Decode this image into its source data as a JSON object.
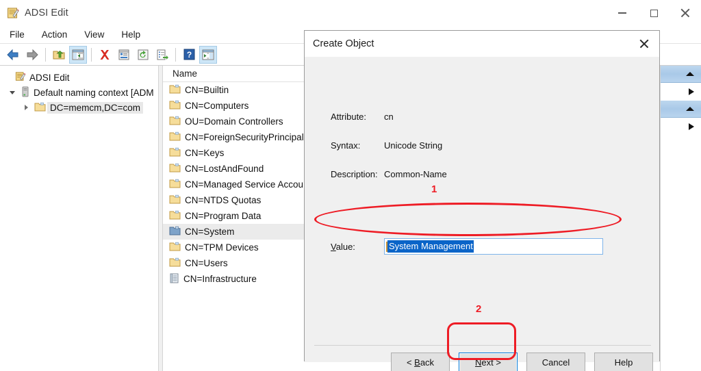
{
  "window": {
    "title": "ADSI Edit",
    "app_icon": "adsi-edit-icon",
    "controls": {
      "minimize": "─",
      "maximize": "□",
      "close": "✕"
    }
  },
  "menubar": {
    "items": [
      "File",
      "Action",
      "View",
      "Help"
    ]
  },
  "toolbar": {
    "items": [
      {
        "name": "back-icon",
        "label": "Back",
        "active": false
      },
      {
        "name": "forward-icon",
        "label": "Forward",
        "active": false
      },
      {
        "name": "up-one-level-icon",
        "label": "Up One Level",
        "active": false
      },
      {
        "name": "show-hide-console-tree-icon",
        "label": "Show/Hide Console Tree",
        "active": true
      },
      {
        "name": "delete-icon",
        "label": "Delete",
        "active": false
      },
      {
        "name": "properties-icon",
        "label": "Properties",
        "active": false
      },
      {
        "name": "refresh-icon",
        "label": "Refresh",
        "active": false
      },
      {
        "name": "export-list-icon",
        "label": "Export List",
        "active": false
      },
      {
        "name": "help-icon",
        "label": "Help",
        "active": false
      },
      {
        "name": "show-hide-action-pane-icon",
        "label": "Show/Hide Action Pane",
        "active": true
      }
    ]
  },
  "tree": {
    "nodes": [
      {
        "label": "ADSI Edit",
        "icon": "adsi-edit-icon",
        "indent": 0,
        "twisty": "none",
        "selected": false
      },
      {
        "label": "Default naming context [ADM",
        "icon": "server-icon",
        "indent": 1,
        "twisty": "expanded",
        "selected": false
      },
      {
        "label": "DC=memcm,DC=com",
        "icon": "folder-icon",
        "indent": 2,
        "twisty": "collapsed",
        "selected": true
      }
    ]
  },
  "list": {
    "column_header": "Name",
    "rows": [
      {
        "name": "CN=Builtin",
        "icon": "folder-icon",
        "selected": false
      },
      {
        "name": "CN=Computers",
        "icon": "folder-icon",
        "selected": false
      },
      {
        "name": "OU=Domain Controllers",
        "icon": "folder-icon",
        "selected": false
      },
      {
        "name": "CN=ForeignSecurityPrincipal",
        "icon": "folder-icon",
        "selected": false
      },
      {
        "name": "CN=Keys",
        "icon": "folder-icon",
        "selected": false
      },
      {
        "name": "CN=LostAndFound",
        "icon": "folder-icon",
        "selected": false
      },
      {
        "name": "CN=Managed Service Accou.",
        "icon": "folder-icon",
        "selected": false
      },
      {
        "name": "CN=NTDS Quotas",
        "icon": "folder-icon",
        "selected": false
      },
      {
        "name": "CN=Program Data",
        "icon": "folder-icon",
        "selected": false
      },
      {
        "name": "CN=System",
        "icon": "folder-icon-selected",
        "selected": true
      },
      {
        "name": "CN=TPM Devices",
        "icon": "folder-icon",
        "selected": false
      },
      {
        "name": "CN=Users",
        "icon": "folder-icon",
        "selected": false
      },
      {
        "name": "CN=Infrastructure",
        "icon": "object-icon",
        "selected": false
      }
    ]
  },
  "actions_pane": {
    "groups": [
      {
        "header_icon": "chevron-up-icon",
        "item_icon": "chevron-right-icon"
      },
      {
        "header_icon": "chevron-up-icon",
        "item_icon": "chevron-right-icon"
      }
    ]
  },
  "dialog": {
    "title": "Create Object",
    "close_icon": "close-icon",
    "fields": [
      {
        "label": "Attribute:",
        "value": "cn"
      },
      {
        "label": "Syntax:",
        "value": "Unicode String"
      },
      {
        "label": "Description:",
        "value": "Common-Name"
      }
    ],
    "value_field": {
      "label": "Value:",
      "label_accesskey": "V",
      "text": "System Management",
      "selected": true
    },
    "buttons": [
      {
        "label": "< Back",
        "accesskey": "B",
        "focused": false
      },
      {
        "label": "Next >",
        "accesskey": "N",
        "focused": true
      },
      {
        "label": "Cancel",
        "accesskey": "",
        "focused": false
      },
      {
        "label": "Help",
        "accesskey": "",
        "focused": false
      }
    ]
  },
  "annotations": {
    "color": "#ee1c25",
    "markers": [
      {
        "number": "1",
        "target": "value-field-row"
      },
      {
        "number": "2",
        "target": "next-button"
      }
    ]
  }
}
